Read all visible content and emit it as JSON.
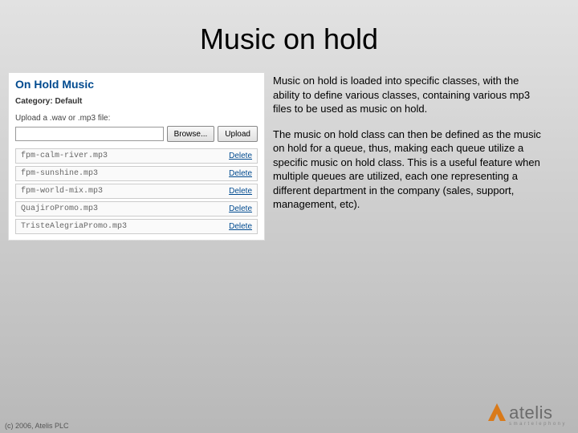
{
  "title": "Music on hold",
  "panel": {
    "title": "On Hold Music",
    "category_label": "Category: Default",
    "upload_label": "Upload a .wav or .mp3 file:",
    "browse_label": "Browse...",
    "upload_btn_label": "Upload",
    "files": [
      {
        "name": "fpm-calm-river.mp3",
        "action": "Delete"
      },
      {
        "name": "fpm-sunshine.mp3",
        "action": "Delete"
      },
      {
        "name": "fpm-world-mix.mp3",
        "action": "Delete"
      },
      {
        "name": "QuajiroPromo.mp3",
        "action": "Delete"
      },
      {
        "name": "TristeAlegriaPromo.mp3",
        "action": "Delete"
      }
    ]
  },
  "description": {
    "p1": "Music on hold is loaded into specific classes, with the ability to define various classes, containing various mp3 files to be used as music on hold.",
    "p2": "The music on hold class can then be defined as the music on hold for a queue, thus, making each queue utilize a specific music on hold class. This is a useful feature when multiple queues are utilized, each one representing a different department in the company (sales, support, management, etc)."
  },
  "footer": "(c) 2006, Atelis PLC",
  "logo": {
    "name": "atelis",
    "tagline": "smartelephony"
  }
}
